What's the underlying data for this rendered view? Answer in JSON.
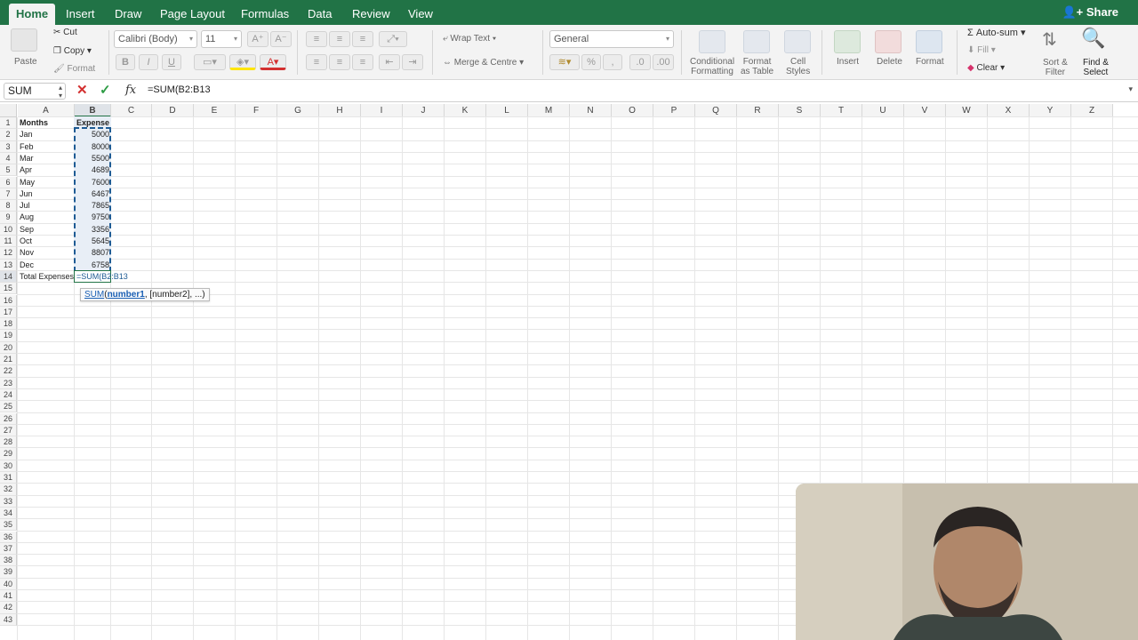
{
  "tabs": [
    {
      "label": "Home",
      "active": true
    },
    {
      "label": "Insert"
    },
    {
      "label": "Draw"
    },
    {
      "label": "Page Layout"
    },
    {
      "label": "Formulas"
    },
    {
      "label": "Data"
    },
    {
      "label": "Review"
    },
    {
      "label": "View"
    }
  ],
  "share_label": "Share",
  "ribbon": {
    "paste": "Paste",
    "cut": "Cut",
    "copy": "Copy",
    "format": "Format",
    "font_name": "Calibri (Body)",
    "font_size": "11",
    "bold": "B",
    "italic": "I",
    "underline": "U",
    "wrap_text": "Wrap Text",
    "merge_centre": "Merge & Centre",
    "number_format": "General",
    "conditional_formatting": [
      "Conditional",
      "Formatting"
    ],
    "format_as_table": [
      "Format",
      "as Table"
    ],
    "cell_styles": [
      "Cell",
      "Styles"
    ],
    "insert": "Insert",
    "delete": "Delete",
    "format_cells": "Format",
    "autosum": "Auto-sum",
    "fill": "Fill",
    "clear": "Clear",
    "sort_filter": [
      "Sort &",
      "Filter"
    ],
    "find_select": [
      "Find &",
      "Select"
    ]
  },
  "formula_bar": {
    "name_box": "SUM",
    "fx": "fx",
    "formula": "=SUM(B2:B13"
  },
  "columns": [
    "A",
    "B",
    "C",
    "D",
    "E",
    "F",
    "G",
    "H",
    "I",
    "J",
    "K",
    "L",
    "M",
    "N",
    "O",
    "P",
    "Q",
    "R",
    "S",
    "T",
    "U",
    "V",
    "W",
    "X",
    "Y",
    "Z"
  ],
  "row_count": 43,
  "sheet": {
    "header_a": "Months",
    "header_b": "Expense",
    "rows": [
      {
        "month": "Jan",
        "expense": "5000"
      },
      {
        "month": "Feb",
        "expense": "8000"
      },
      {
        "month": "Mar",
        "expense": "5500"
      },
      {
        "month": "Apr",
        "expense": "4689"
      },
      {
        "month": "May",
        "expense": "7600"
      },
      {
        "month": "Jun",
        "expense": "6467"
      },
      {
        "month": "Jul",
        "expense": "7865"
      },
      {
        "month": "Aug",
        "expense": "9750"
      },
      {
        "month": "Sep",
        "expense": "3356"
      },
      {
        "month": "Oct",
        "expense": "5645"
      },
      {
        "month": "Nov",
        "expense": "8807"
      },
      {
        "month": "Dec",
        "expense": "6758"
      }
    ],
    "total_label": "Total Expenses",
    "total_formula": "=SUM(B2:B13"
  },
  "tooltip": {
    "fn": "SUM",
    "open": "(",
    "arg1": "number1",
    "rest": ", [number2], ...)"
  },
  "colors": {
    "tab_bar": "#217346",
    "ribbon_bg": "#f3f3f3",
    "selection_border": "#1e5b94",
    "selection_fill": "#e8eef6",
    "cancel_red": "#d32f2f",
    "confirm_green": "#2e9c45"
  }
}
